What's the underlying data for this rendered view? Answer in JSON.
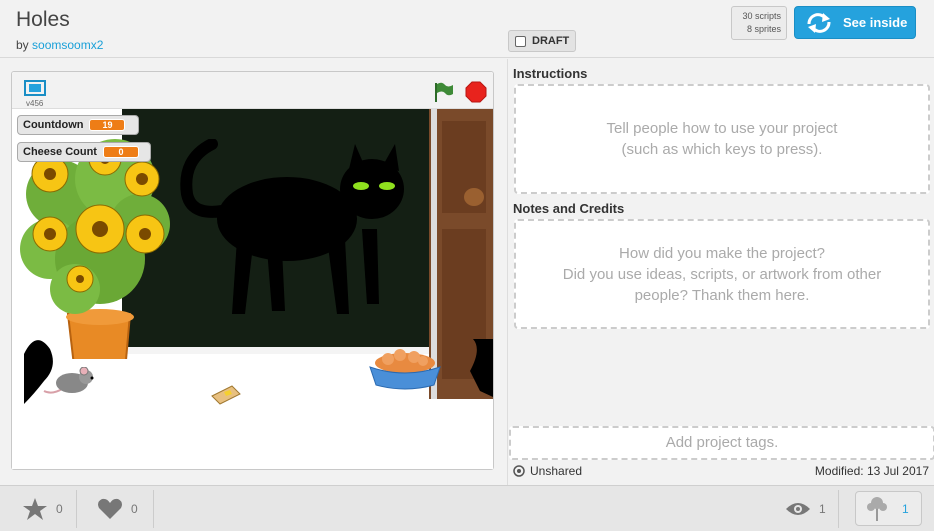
{
  "header": {
    "title": "Holes",
    "by_label": "by",
    "author": "soomsoomx2",
    "draft_label": "DRAFT",
    "scripts_count": "30 scripts",
    "sprites_count": "8 sprites",
    "see_inside_label": "See inside"
  },
  "player": {
    "version": "v456",
    "monitors": [
      {
        "label": "Countdown",
        "value": "19"
      },
      {
        "label": "Cheese Count",
        "value": "0"
      }
    ]
  },
  "instructions": {
    "label": "Instructions",
    "placeholder_line1": "Tell people how to use your project",
    "placeholder_line2": "(such as which keys to press)."
  },
  "notes": {
    "label": "Notes and Credits",
    "placeholder_line1": "How did you make the project?",
    "placeholder_line2": "Did you use ideas, scripts, or artwork from other",
    "placeholder_line3": "people? Thank them here."
  },
  "tags_placeholder": "Add project tags.",
  "status": {
    "shared": "Unshared",
    "modified": "Modified: 13 Jul 2017"
  },
  "footer": {
    "favorites": "0",
    "loves": "0",
    "views": "1",
    "remixes": "1"
  },
  "colors": {
    "accent": "#25a2dd",
    "monitor_value": "#ee7d16",
    "stop": "#e8231d",
    "flag": "#3e8a37"
  }
}
